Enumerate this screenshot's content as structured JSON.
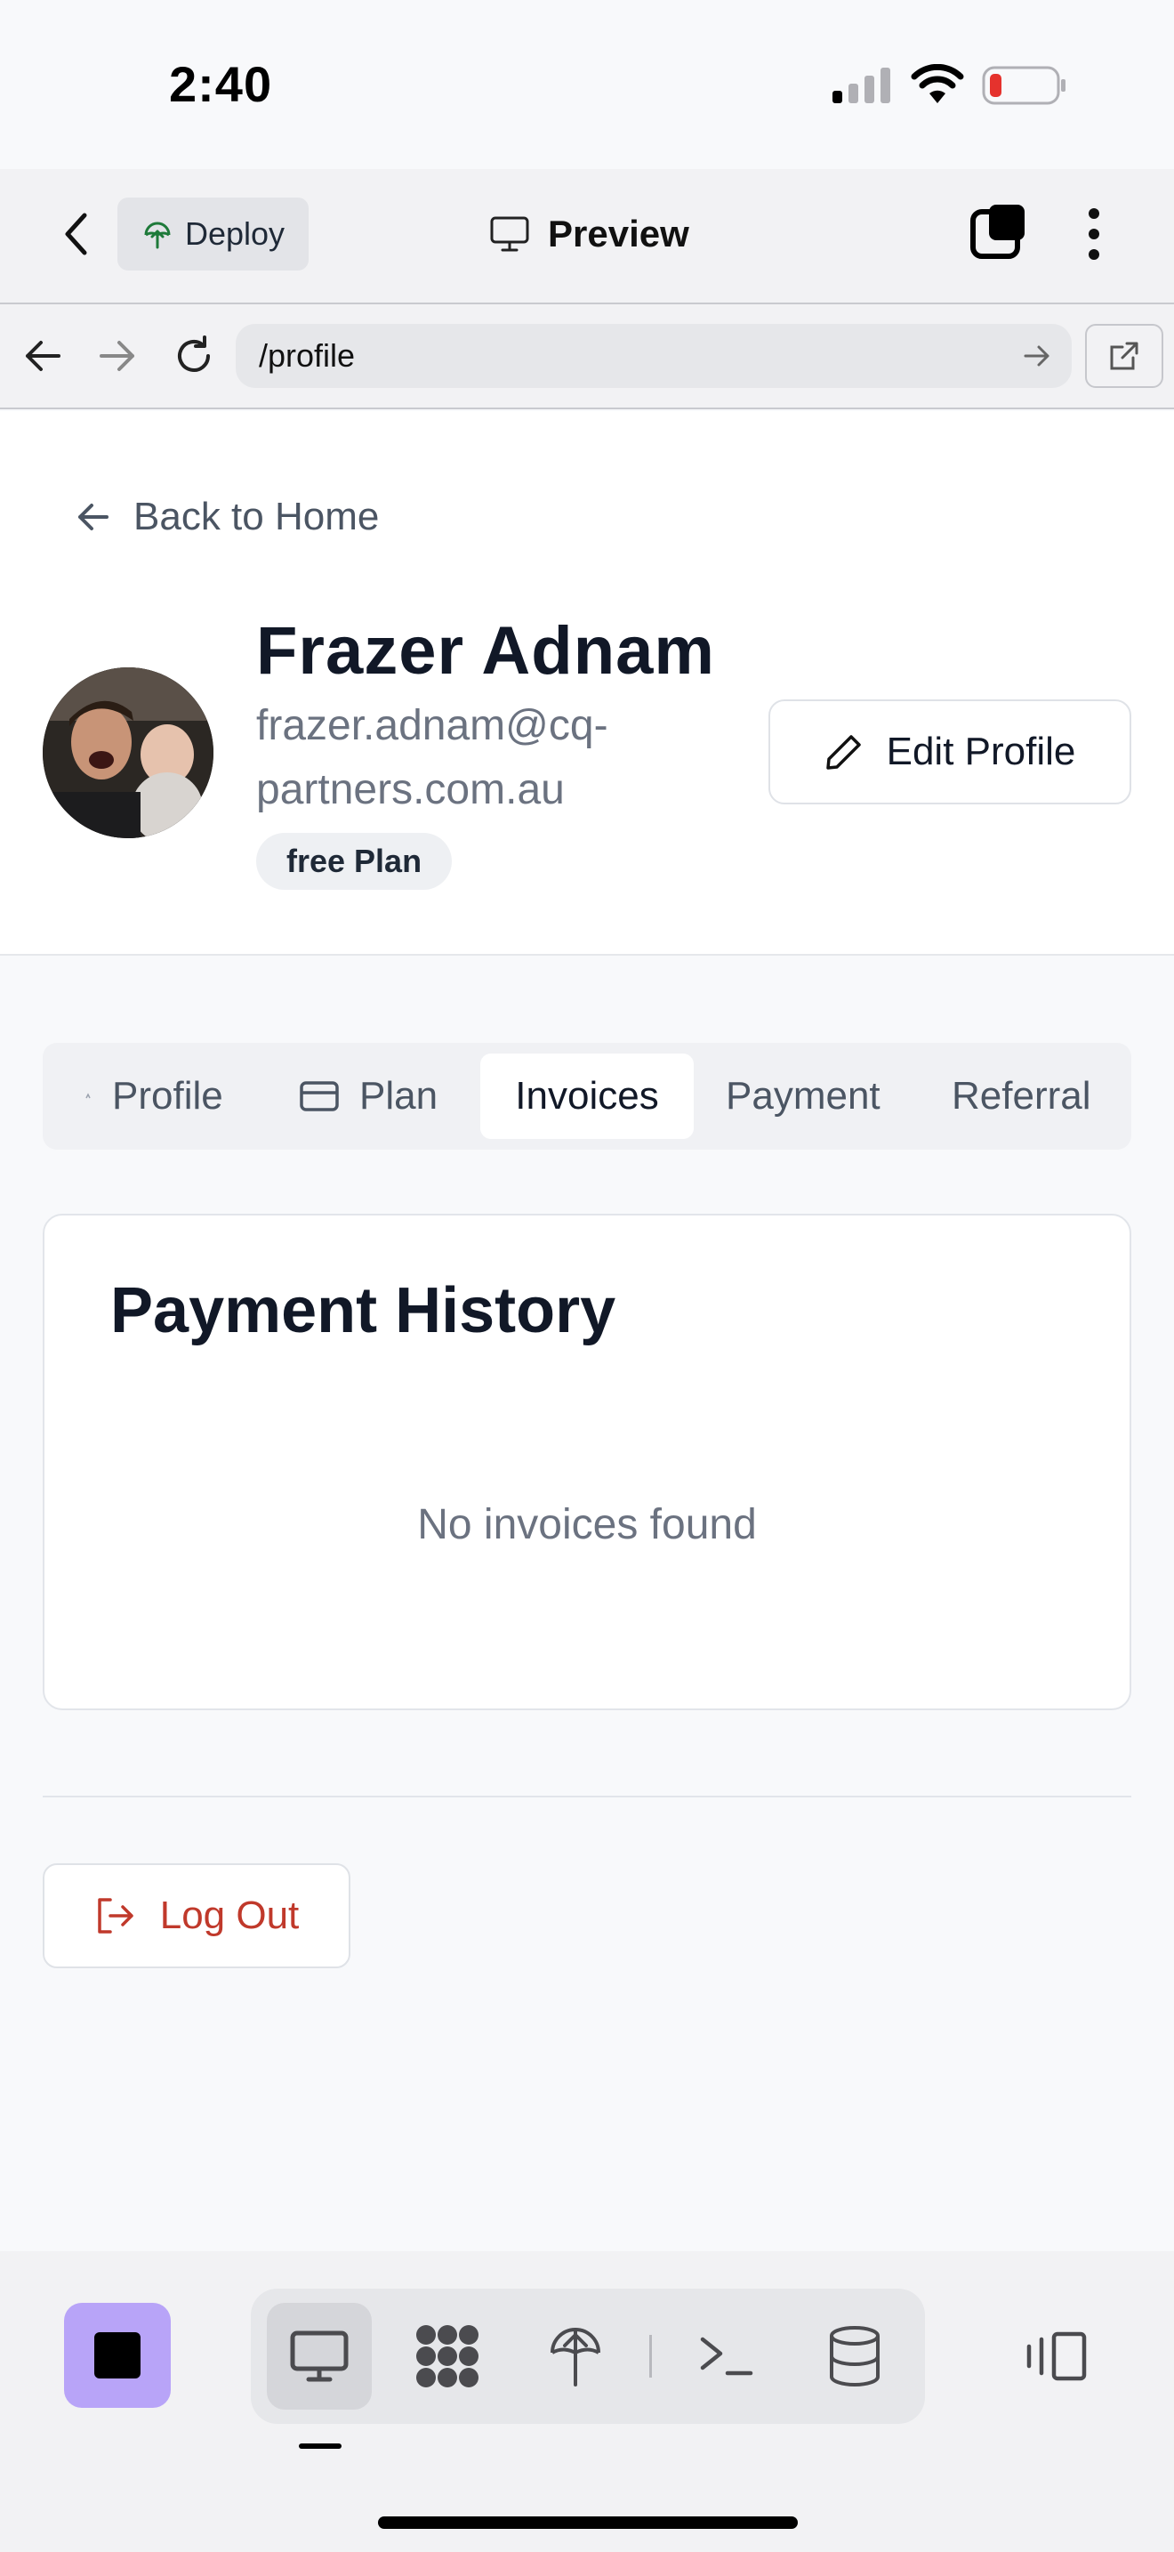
{
  "status_bar": {
    "time": "2:40",
    "icons": [
      "signal-icon",
      "wifi-icon",
      "battery-low-icon"
    ]
  },
  "toolbar": {
    "back_icon": "chevron-left-icon",
    "deploy_label": "Deploy",
    "preview_label": "Preview",
    "tabs_icon": "tabs-icon",
    "more_icon": "more-vertical-icon"
  },
  "browser": {
    "url": "/profile",
    "icons": [
      "arrow-left-icon",
      "arrow-right-icon",
      "refresh-icon",
      "go-arrow-icon",
      "external-link-icon"
    ]
  },
  "profile": {
    "back_label": "Back to Home",
    "name": "Frazer Adnam",
    "email": "frazer.adnam@cq-partners.com.au",
    "plan": "free Plan",
    "edit_label": "Edit Profile"
  },
  "tabs": [
    {
      "label": "Profile",
      "active": false
    },
    {
      "label": "Plan",
      "active": false
    },
    {
      "label": "Invoices",
      "active": true
    },
    {
      "label": "Payment",
      "active": false
    },
    {
      "label": "Referral",
      "active": false
    }
  ],
  "invoices": {
    "title": "Payment History",
    "empty_message": "No invoices found"
  },
  "logout_label": "Log Out",
  "colors": {
    "accent_purple": "#b8a4f8",
    "danger_red": "#c0392b",
    "text_primary": "#111827",
    "text_muted": "#6b7280"
  },
  "dock": {
    "tools": [
      "monitor-icon",
      "apps-grid-icon",
      "deploy-icon",
      "terminal-icon",
      "database-icon",
      "panel-toggle-icon"
    ]
  }
}
